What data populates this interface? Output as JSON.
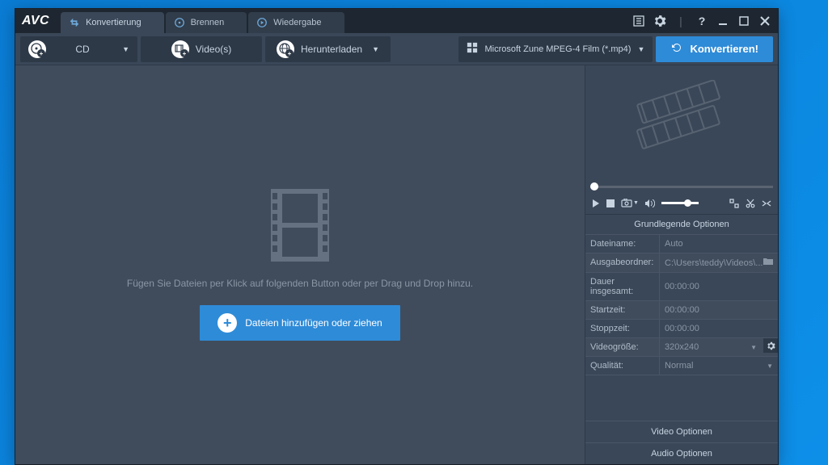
{
  "app": {
    "logo": "AVC"
  },
  "tabs": [
    {
      "label": "Konvertierung"
    },
    {
      "label": "Brennen"
    },
    {
      "label": "Wiedergabe"
    }
  ],
  "toolbar": {
    "cd": "CD",
    "video": "Video(s)",
    "download": "Herunterladen",
    "format": "Microsoft Zune MPEG-4 Film (*.mp4)",
    "convert": "Konvertieren!"
  },
  "dropzone": {
    "hint": "Fügen Sie Dateien per Klick auf folgenden Button oder per Drag und Drop hinzu.",
    "add_button": "Dateien hinzufügen oder ziehen"
  },
  "options": {
    "header": "Grundlegende Optionen",
    "rows": [
      {
        "label": "Dateiname:",
        "value": "Auto"
      },
      {
        "label": "Ausgabeordner:",
        "value": "C:\\Users\\teddy\\Videos\\..."
      },
      {
        "label": "Dauer insgesamt:",
        "value": "00:00:00"
      },
      {
        "label": "Startzeit:",
        "value": "00:00:00"
      },
      {
        "label": "Stoppzeit:",
        "value": "00:00:00"
      },
      {
        "label": "Videogröße:",
        "value": "320x240"
      },
      {
        "label": "Qualität:",
        "value": "Normal"
      }
    ],
    "video_section": "Video Optionen",
    "audio_section": "Audio Optionen"
  }
}
